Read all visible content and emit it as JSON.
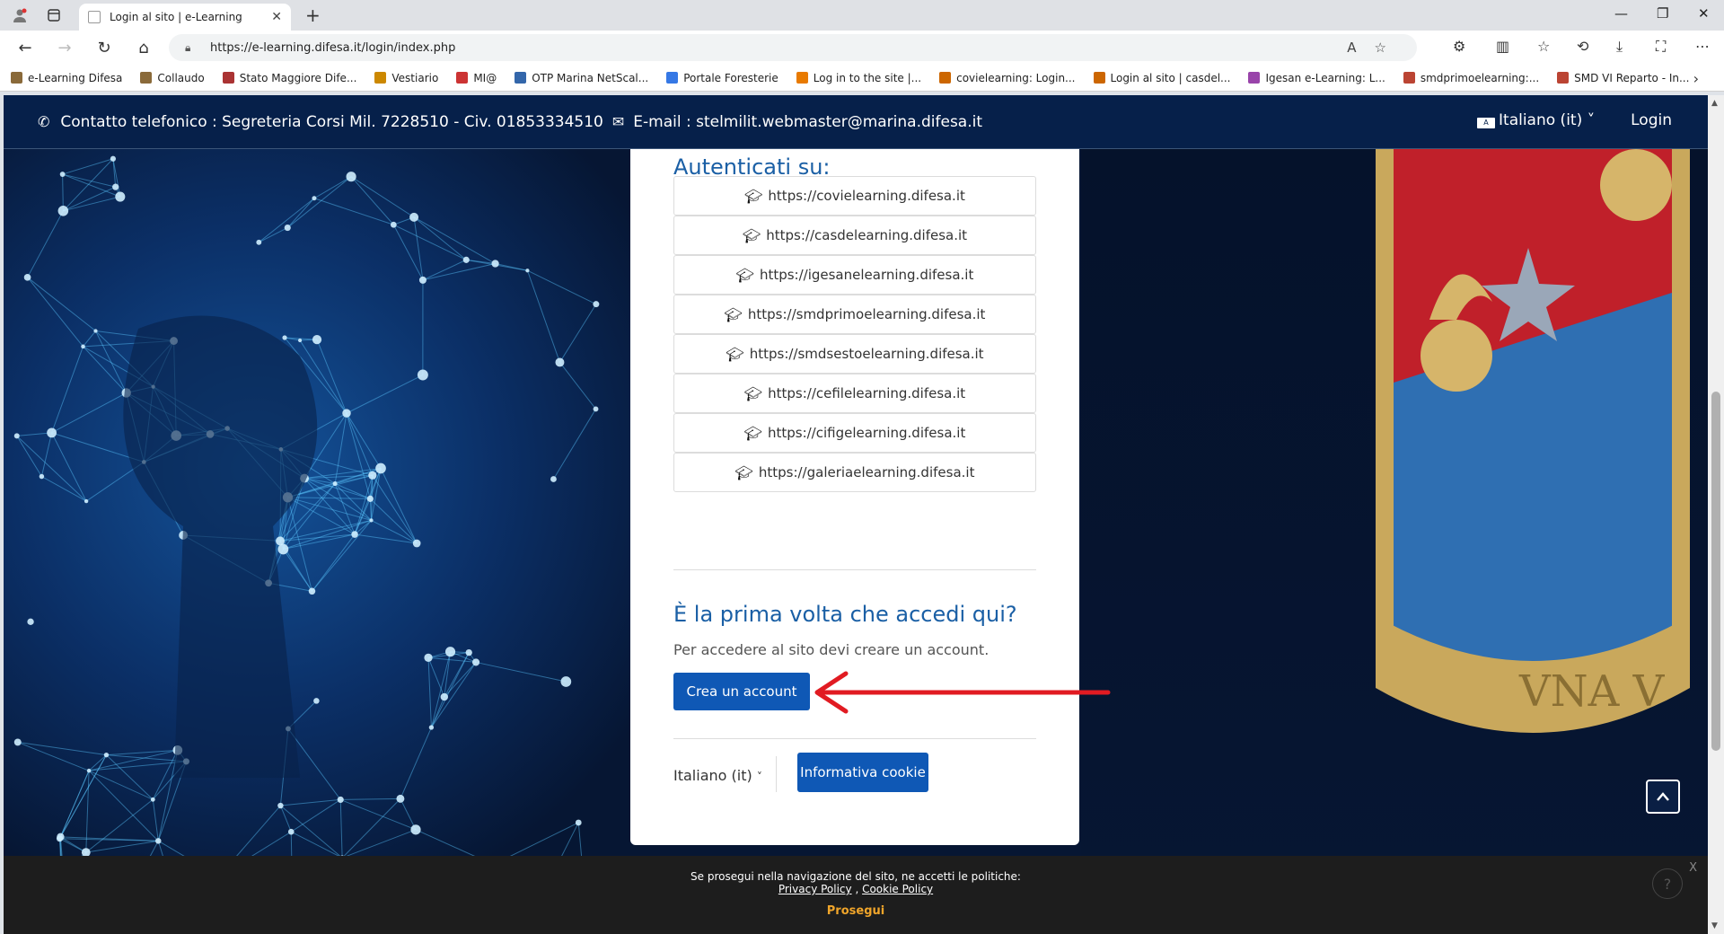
{
  "browser": {
    "tab_title": "Login al sito | e-Learning",
    "url": "https://e-learning.difesa.it/login/index.php",
    "bookmarks": [
      {
        "label": "e-Learning Difesa",
        "color": "#8a6a3a"
      },
      {
        "label": "Collaudo",
        "color": "#8a6a3a"
      },
      {
        "label": "Stato Maggiore Dife...",
        "color": "#a33"
      },
      {
        "label": "Vestiario",
        "color": "#c80"
      },
      {
        "label": "MI@",
        "color": "#c33"
      },
      {
        "label": "OTP Marina NetScal...",
        "color": "#36a"
      },
      {
        "label": "Portale Foresterie",
        "color": "#3578e5"
      },
      {
        "label": "Log in to the site |...",
        "color": "#e87a00"
      },
      {
        "label": "covielearning: Login...",
        "color": "#c60"
      },
      {
        "label": "Login al sito | casdel...",
        "color": "#c60"
      },
      {
        "label": "Igesan e-Learning: L...",
        "color": "#94a"
      },
      {
        "label": "smdprimoelearning:...",
        "color": "#b43"
      },
      {
        "label": "SMD VI Reparto - In...",
        "color": "#b43"
      }
    ]
  },
  "topnav": {
    "contact": "Contatto telefonico : Segreteria Corsi Mil. 7228510 - Civ. 01853334510",
    "email": "E-mail : stelmilit.webmaster@marina.difesa.it",
    "language": "Italiano ‎(it)‎",
    "login": "Login"
  },
  "card": {
    "auth_title": "Autenticati su:",
    "providers": [
      "https://covielearning.difesa.it",
      "https://casdelearning.difesa.it",
      "https://igesanelearning.difesa.it",
      "https://smdprimoelearning.difesa.it",
      "https://smdsestoelearning.difesa.it",
      "https://cefilelearning.difesa.it",
      "https://cifigelearning.difesa.it",
      "https://galeriaelearning.difesa.it"
    ],
    "first_time_title": "È la prima volta che accedi qui?",
    "first_time_desc": "Per accedere al sito devi creare un account.",
    "create_account": "Crea un account",
    "footer_language": "Italiano ‎(it)‎",
    "cookie_button": "Informativa cookie"
  },
  "crest_text": "VNA V",
  "cookiebar": {
    "line1": "Se prosegui nella navigazione del sito, ne accetti le politiche:",
    "privacy": "Privacy Policy",
    "cookie": "Cookie Policy",
    "continue": "Prosegui",
    "close": "X"
  },
  "colors": {
    "nav_bg": "#06204a",
    "accent": "#1a5fa5",
    "button": "#0f58b5",
    "arrow": "#e11b22"
  }
}
